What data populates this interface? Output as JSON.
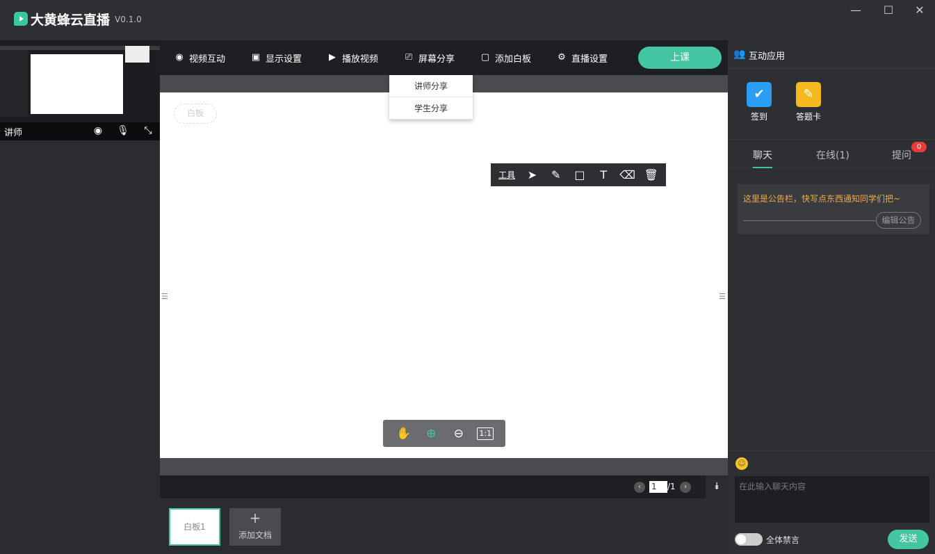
{
  "app": {
    "title": "大黄蜂云直播",
    "version": "V0.1.0"
  },
  "window": {
    "minimize": "—",
    "maximize": "☐",
    "close": "✕"
  },
  "teacher": {
    "label": "讲师"
  },
  "toolbar": {
    "video_interaction": "视频互动",
    "display_settings": "显示设置",
    "play_video": "播放视频",
    "screen_share": "屏幕分享",
    "add_whiteboard": "添加白板",
    "live_settings": "直播设置",
    "start_class": "上课"
  },
  "share_menu": {
    "teacher_share": "讲师分享",
    "student_share": "学生分享"
  },
  "whiteboard": {
    "tag": "白板"
  },
  "draw_tools": {
    "label": "工具"
  },
  "zoom_tools": {
    "fit": "1:1"
  },
  "pager": {
    "current": "1",
    "total": "/1"
  },
  "thumbs": {
    "board1": "白板1",
    "add_doc": "添加文档",
    "add_plus": "+"
  },
  "apps": {
    "title": "互动应用",
    "items": [
      {
        "label": "签到",
        "color": "#2a9df4"
      },
      {
        "label": "答题卡",
        "color": "#f5b81f"
      }
    ]
  },
  "chat": {
    "tabs": {
      "chat": "聊天",
      "online": "在线(1)",
      "question": "提问"
    },
    "question_badge": "0",
    "notice": "这里是公告栏，快写点东西通知同学们把~",
    "edit_notice": "编辑公告",
    "input_placeholder": "在此输入聊天内容",
    "mute_all": "全体禁言",
    "send": "发送"
  },
  "colors": {
    "accent": "#44c6a3",
    "notice": "#f0a942",
    "badge": "#e93b3b"
  }
}
